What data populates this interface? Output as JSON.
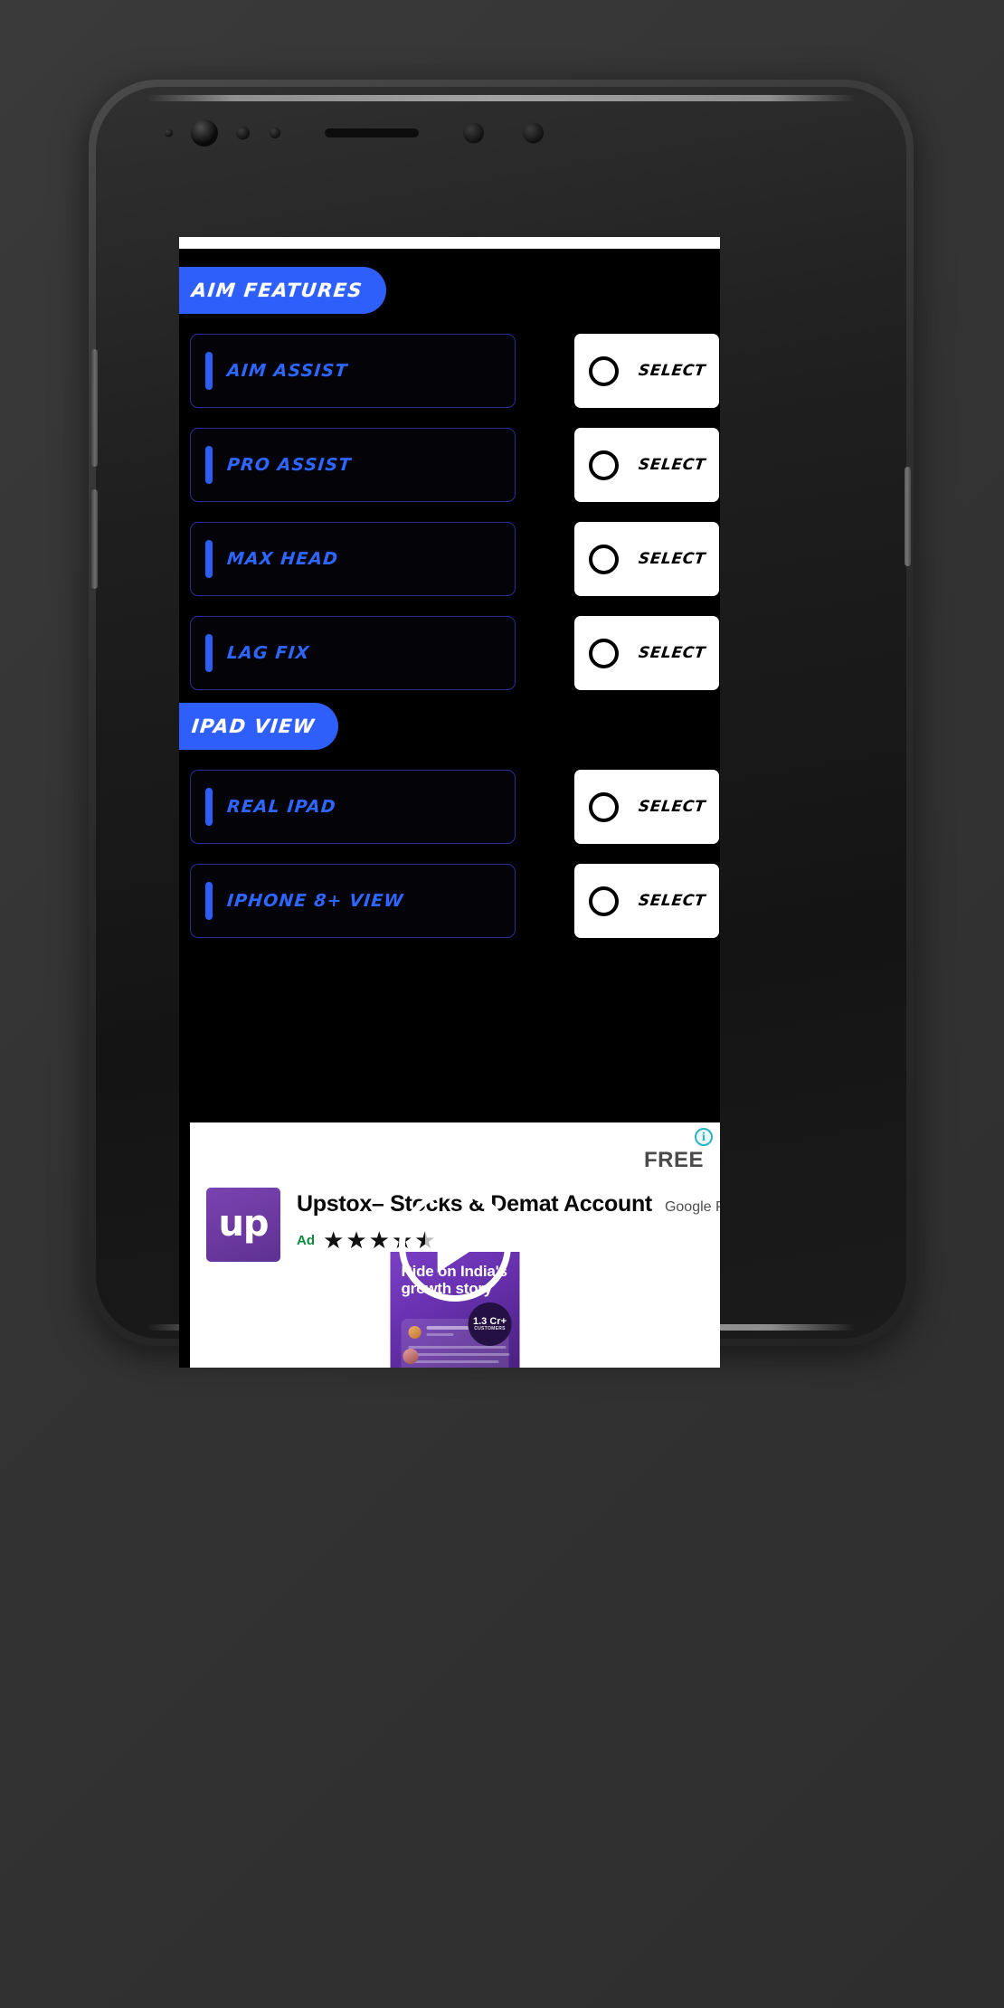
{
  "app": {
    "sections": [
      {
        "badge": "AIM FEATURES",
        "items": [
          {
            "label": "AIM ASSIST",
            "action": "SELECT",
            "selected": false
          },
          {
            "label": "PRO ASSIST",
            "action": "SELECT",
            "selected": false
          },
          {
            "label": "MAX HEAD",
            "action": "SELECT",
            "selected": false
          },
          {
            "label": "LAG FIX",
            "action": "SELECT",
            "selected": false
          }
        ]
      },
      {
        "badge": "IPAD VIEW",
        "items": [
          {
            "label": "REAL IPAD",
            "action": "SELECT",
            "selected": false
          },
          {
            "label": "IPHONE 8+ VIEW",
            "action": "SELECT",
            "selected": false
          }
        ]
      }
    ]
  },
  "ad": {
    "info_glyph": "i",
    "price": "FREE",
    "icon_wordmark": "up",
    "title": "Upstox– Stocks & Demat Account",
    "store": "Google Play",
    "ad_badge": "Ad",
    "rating": 4.5,
    "video": {
      "headline": "Ride on India's growth story",
      "badge_value": "1.3 Cr+",
      "badge_caption": "CUSTOMERS",
      "play_label": "Play"
    }
  },
  "colors": {
    "accent_blue": "#2f5ffb",
    "row_border": "#2a2f8c",
    "label_blue": "#2f66ff",
    "screen_bg": "#000000",
    "ad_bg": "#ffffff",
    "ad_green": "#0e8a3e",
    "info_teal": "#2ab3c0",
    "brand_purple": "#6a32b2"
  }
}
